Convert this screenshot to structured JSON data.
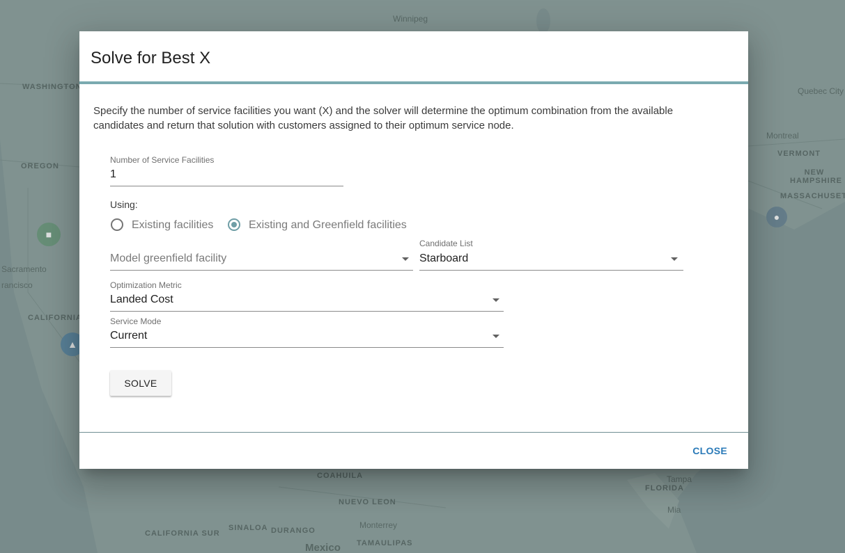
{
  "map": {
    "labels": {
      "washington": "WASHINGTON",
      "oregon": "OREGON",
      "california": "CALIFORNIA",
      "vermont": "VERMONT",
      "new_hampshire": "NEW HAMPSHIRE",
      "massachusetts": "MASSACHUSET",
      "coahuila": "COAHUILA",
      "nuevo_leon": "NUEVO LEON",
      "baja_california_sur": "CALIFORNIA SUR",
      "sinaloa": "SINALOA",
      "durango": "DURANGO",
      "tamaulipas": "TAMAULIPAS",
      "florida": "FLORIDA"
    },
    "cities": {
      "winnipeg": "Winnipeg",
      "montreal": "Montreal",
      "sacramento": "Sacramento",
      "francisco": "rancisco",
      "quebec": "Quebec City",
      "tampa": "Tampa",
      "monterrey": "Monterrey",
      "mexico": "Mexico",
      "miami": "Mia"
    }
  },
  "dialog": {
    "title": "Solve for Best X",
    "description": "Specify the number of service facilities you want (X) and the solver will determine the optimum combination from the available candidates and return that solution with customers assigned to their optimum service node.",
    "num_facilities": {
      "label": "Number of Service Facilities",
      "value": "1"
    },
    "using": {
      "label": "Using:",
      "options": [
        {
          "label": "Existing facilities",
          "checked": false
        },
        {
          "label": "Existing and Greenfield facilities",
          "checked": true
        }
      ]
    },
    "model_greenfield": {
      "placeholder": "Model greenfield facility"
    },
    "candidate_list": {
      "label": "Candidate List",
      "value": "Starboard"
    },
    "optimization_metric": {
      "label": "Optimization Metric",
      "value": "Landed Cost"
    },
    "service_mode": {
      "label": "Service Mode",
      "value": "Current"
    },
    "solve_label": "SOLVE",
    "close_label": "CLOSE"
  },
  "colors": {
    "accent": "#6f9ea6",
    "close_text": "#2a7ab8"
  }
}
